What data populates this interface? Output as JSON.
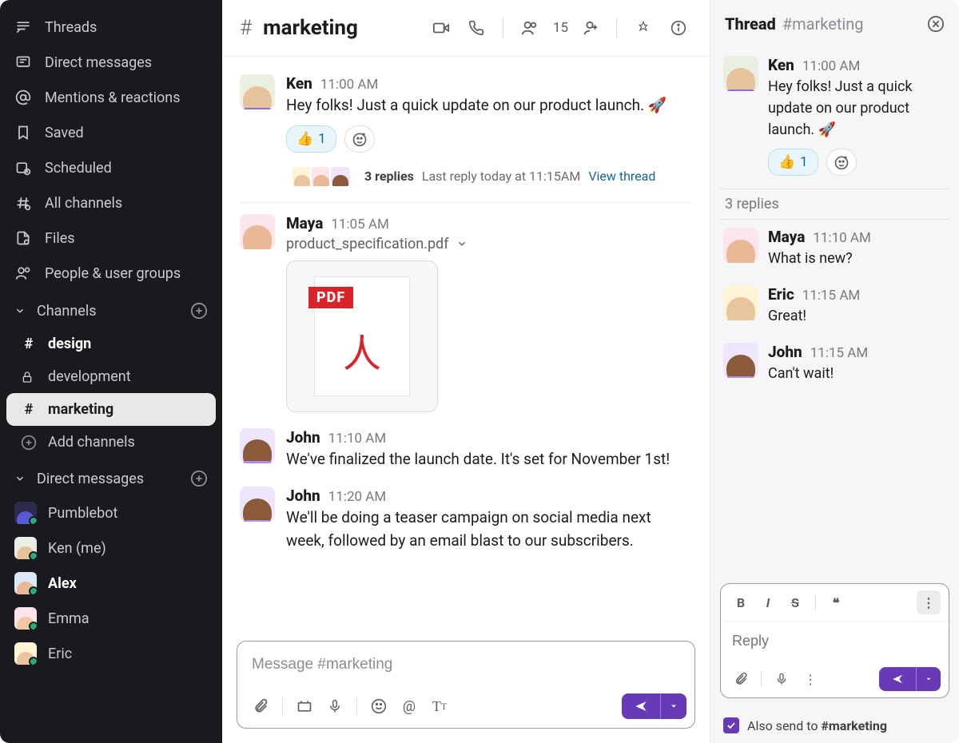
{
  "sidebar": {
    "nav": [
      {
        "label": "Threads"
      },
      {
        "label": "Direct messages"
      },
      {
        "label": "Mentions & reactions"
      },
      {
        "label": "Saved"
      },
      {
        "label": "Scheduled"
      },
      {
        "label": "All channels"
      },
      {
        "label": "Files"
      },
      {
        "label": "People & user groups"
      }
    ],
    "channels_header": "Channels",
    "channels": [
      {
        "name": "design",
        "prefix": "#",
        "bold": true
      },
      {
        "name": "development",
        "prefix": "🔒"
      },
      {
        "name": "marketing",
        "prefix": "#",
        "active": true
      }
    ],
    "add_channels": "Add channels",
    "dms_header": "Direct messages",
    "dms": [
      {
        "name": "Pumblebot",
        "avatar": "bot"
      },
      {
        "name": "Ken (me)",
        "avatar": "ken"
      },
      {
        "name": "Alex",
        "avatar": "alex",
        "bold": true
      },
      {
        "name": "Emma",
        "avatar": "emma"
      },
      {
        "name": "Eric",
        "avatar": "eric"
      }
    ]
  },
  "channel": {
    "hash": "#",
    "name": "marketing",
    "member_count": "15"
  },
  "messages": [
    {
      "author": "Ken",
      "time": "11:00 AM",
      "avatar": "ken",
      "text": "Hey folks! Just a quick update on our product launch. 🚀",
      "reaction": {
        "emoji": "👍",
        "count": "1"
      },
      "thread": {
        "replies": "3 replies",
        "last": "Last reply today at 11:15AM",
        "link": "View thread",
        "avatars": [
          "eric",
          "maya",
          "john"
        ]
      }
    },
    {
      "author": "Maya",
      "time": "11:05 AM",
      "avatar": "maya",
      "file": {
        "name": "product_specification.pdf",
        "badge": "PDF"
      }
    },
    {
      "author": "John",
      "time": "11:10 AM",
      "avatar": "john",
      "text": "We've finalized the launch date. It's set for November 1st!"
    },
    {
      "author": "John",
      "time": "11:20 AM",
      "avatar": "john",
      "text": "We'll be doing a teaser campaign on social media next week, followed by an email blast to our subscribers."
    }
  ],
  "composer": {
    "placeholder": "Message #marketing"
  },
  "thread": {
    "title": "Thread",
    "channel": "#marketing",
    "root": {
      "author": "Ken",
      "time": "11:00 AM",
      "avatar": "ken",
      "text": "Hey folks! Just a quick update on our product launch. 🚀",
      "reaction": {
        "emoji": "👍",
        "count": "1"
      }
    },
    "reply_count": "3 replies",
    "replies": [
      {
        "author": "Maya",
        "time": "11:10 AM",
        "avatar": "maya",
        "text": "What is new?"
      },
      {
        "author": "Eric",
        "time": "11:15 AM",
        "avatar": "eric",
        "text": "Great!"
      },
      {
        "author": "John",
        "time": "11:15 AM",
        "avatar": "john",
        "text": "Can't wait!"
      }
    ],
    "reply_placeholder": "Reply",
    "also_send_prefix": "Also send to ",
    "also_send_channel": "#marketing",
    "also_send_checked": true
  }
}
